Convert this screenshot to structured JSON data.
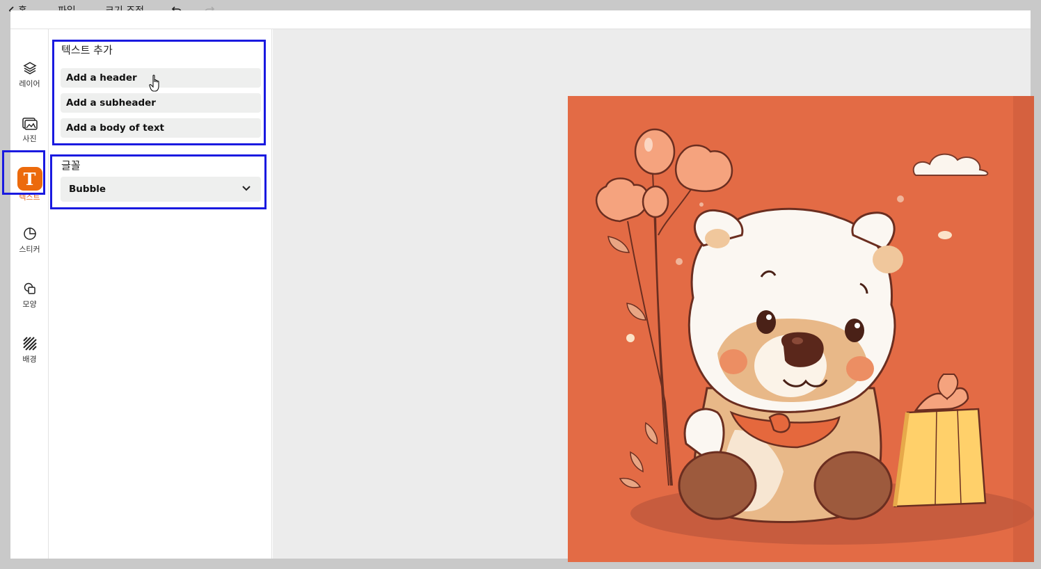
{
  "topbar": {
    "home_label": "홈",
    "file_label": "파일",
    "resize_label": "크기 조정",
    "undo_icon": "undo-icon",
    "redo_icon": "redo-icon"
  },
  "rail": {
    "items": [
      {
        "label": "레이어",
        "icon": "layers-icon"
      },
      {
        "label": "사진",
        "icon": "photos-icon"
      },
      {
        "label": "텍스트",
        "icon": "text-icon",
        "badge": "T",
        "active": true
      },
      {
        "label": "스티커",
        "icon": "sticker-icon"
      },
      {
        "label": "모양",
        "icon": "shapes-icon"
      },
      {
        "label": "배경",
        "icon": "background-icon"
      }
    ]
  },
  "panel": {
    "add_text_title": "텍스트 추가",
    "add_header": "Add a header",
    "add_subheader": "Add a subheader",
    "add_body": "Add a body of text",
    "font_title": "글꼴",
    "font_selected": "Bubble"
  },
  "colors": {
    "accent": "#ec6a0c",
    "highlight": "#1a1ae0",
    "artboard_bg": "#e36b45"
  }
}
